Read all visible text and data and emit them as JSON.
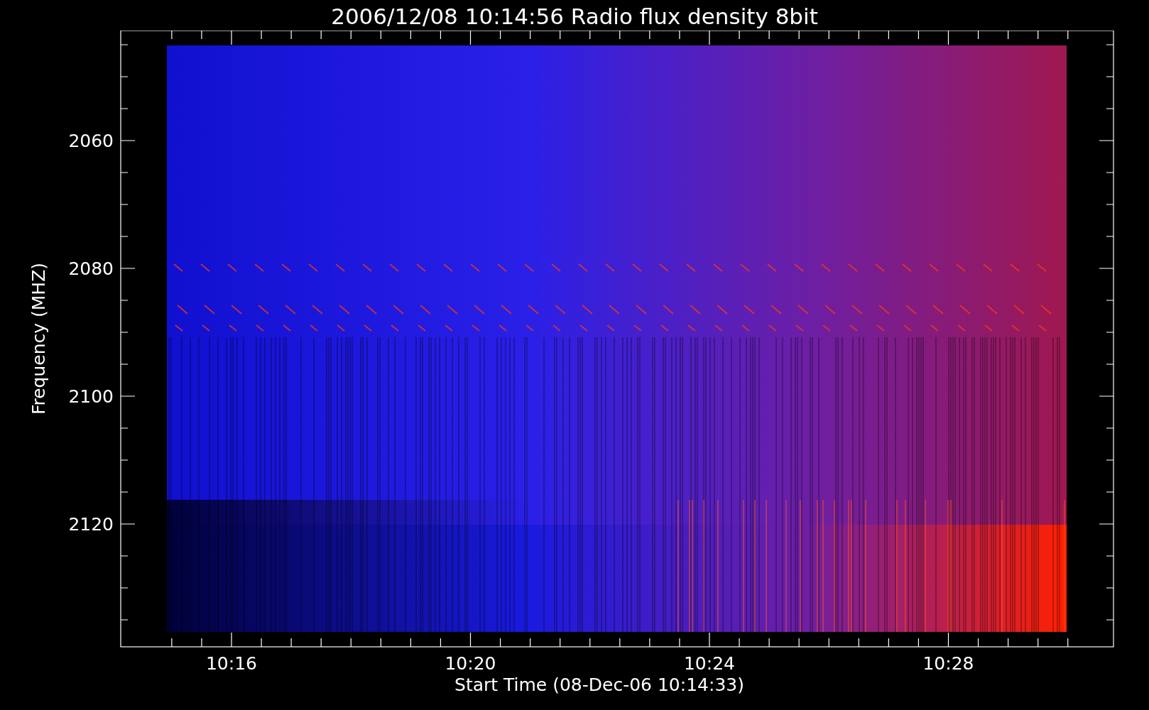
{
  "title": "2006/12/08 10:14:56 Radio flux density 8bit",
  "y_axis": {
    "label": "Frequency (MHZ)",
    "ticks": [
      "2060",
      "2080",
      "2100",
      "2120"
    ]
  },
  "x_axis": {
    "label": "Start Time (08-Dec-06 10:14:33)",
    "ticks": [
      "10:16",
      "10:20",
      "10:24",
      "10:28"
    ]
  }
}
